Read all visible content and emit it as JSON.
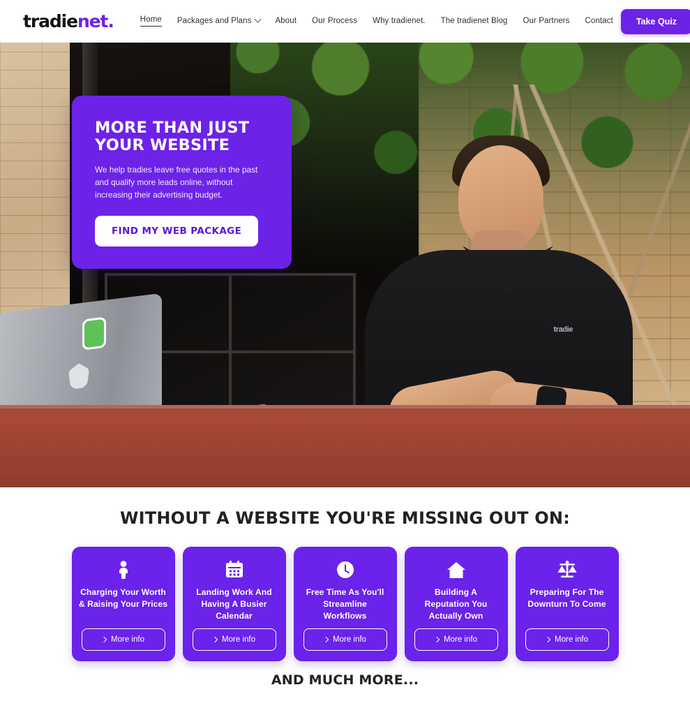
{
  "header": {
    "logo": {
      "part1": "tradie",
      "part2": "net.",
      "accent_color": "#6d22e8"
    },
    "nav": [
      {
        "label": "Home",
        "active": true,
        "has_dropdown": false
      },
      {
        "label": "Packages and Plans",
        "active": false,
        "has_dropdown": true
      },
      {
        "label": "About",
        "active": false,
        "has_dropdown": false
      },
      {
        "label": "Our Process",
        "active": false,
        "has_dropdown": false
      },
      {
        "label": "Why tradienet.",
        "active": false,
        "has_dropdown": false
      },
      {
        "label": "The tradienet Blog",
        "active": false,
        "has_dropdown": false
      },
      {
        "label": "Our Partners",
        "active": false,
        "has_dropdown": false
      },
      {
        "label": "Contact",
        "active": false,
        "has_dropdown": false
      }
    ],
    "cta_label": "Take Quiz"
  },
  "hero": {
    "title": "MORE THAN JUST YOUR WEBSITE",
    "subtitle": "We help tradies leave free quotes in the past and qualify more leads online, without increasing their advertising budget.",
    "cta_label": "FIND MY WEB PACKAGE",
    "card_color": "#6d22e8",
    "photo_alt": "Tradesman in black tradienet polo shirt working at a red picnic table with a laptop, notebook and phone"
  },
  "features": {
    "heading": "WITHOUT A WEBSITE YOU'RE MISSING OUT ON:",
    "footer": "AND MUCH MORE...",
    "card_color": "#6b22ea",
    "cards": [
      {
        "icon": "person-icon",
        "title": "Charging Your Worth & Raising Your Prices",
        "button": "More info"
      },
      {
        "icon": "calendar-icon",
        "title": "Landing Work And Having A Busier Calendar",
        "button": "More info"
      },
      {
        "icon": "clock-icon",
        "title": "Free Time As You'll Streamline Workflows",
        "button": "More info"
      },
      {
        "icon": "home-icon",
        "title": "Building A Reputation You Actually Own",
        "button": "More info"
      },
      {
        "icon": "scales-icon",
        "title": "Preparing For The Downturn To Come",
        "button": "More info"
      }
    ]
  }
}
